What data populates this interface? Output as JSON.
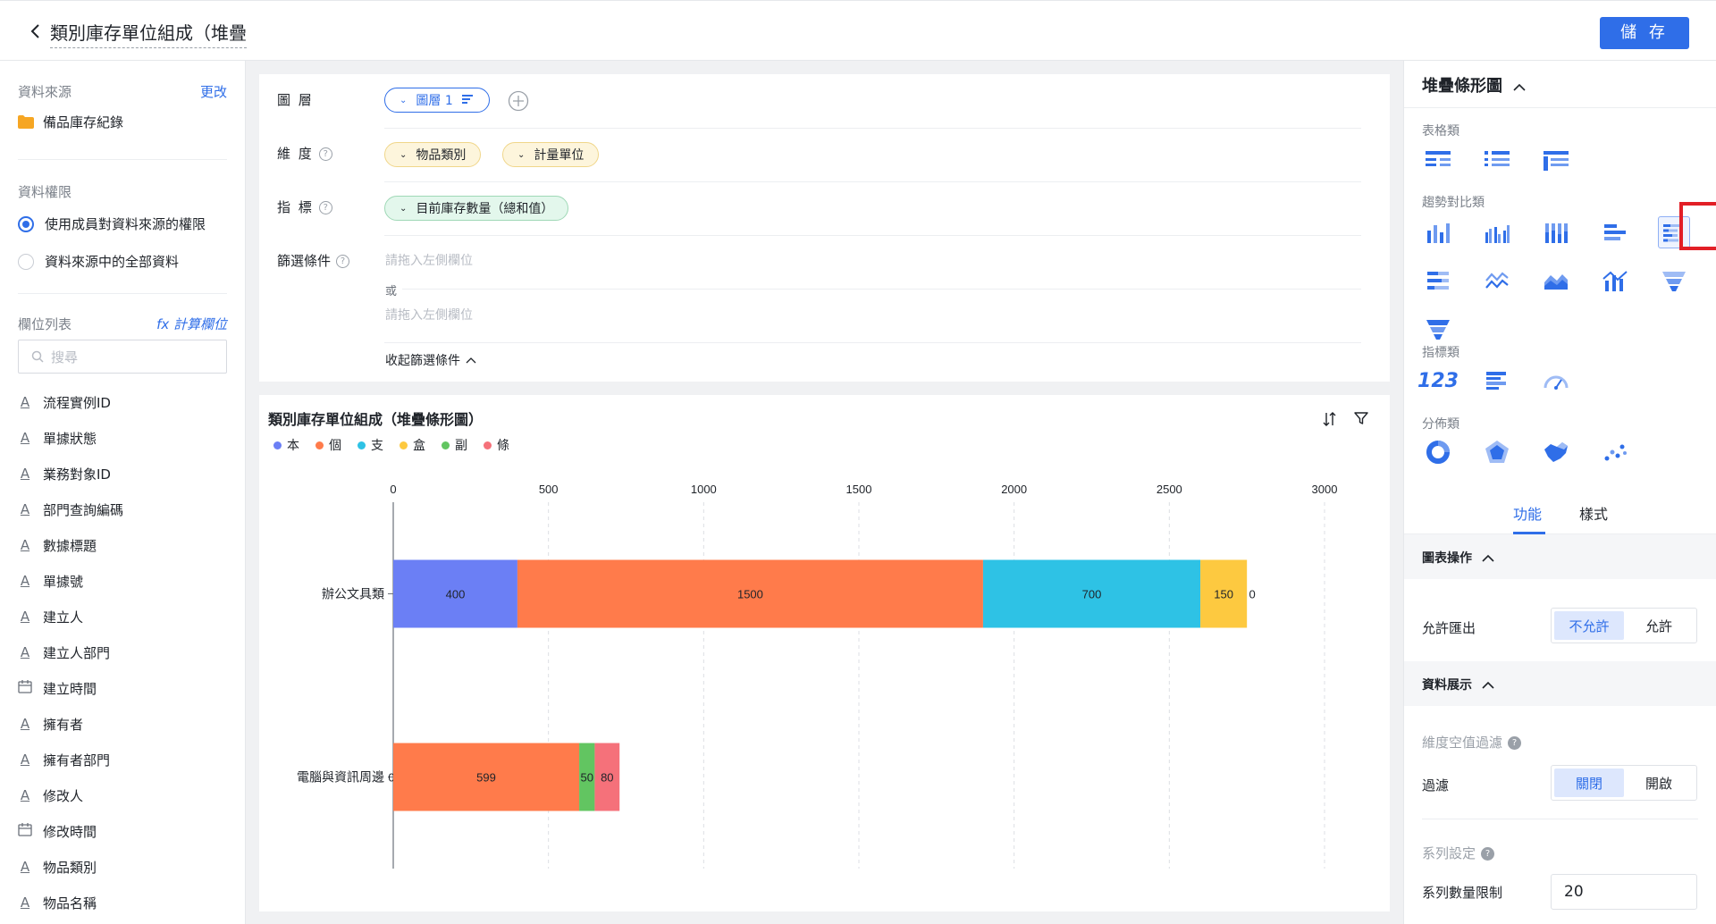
{
  "header": {
    "title": "類別庫存單位組成（堆疊",
    "save_label": "儲 存"
  },
  "left": {
    "source_label": "資料來源",
    "change_link": "更改",
    "source_name": "備品庫存紀錄",
    "perm_label": "資料權限",
    "perm_options": [
      "使用成員對資料來源的權限",
      "資料來源中的全部資料"
    ],
    "fields_label": "欄位列表",
    "calc_link": "fx 計算欄位",
    "search_placeholder": "搜尋",
    "fields": [
      {
        "name": "流程實例ID",
        "type": "A"
      },
      {
        "name": "單據狀態",
        "type": "A"
      },
      {
        "name": "業務對象ID",
        "type": "A"
      },
      {
        "name": "部門查詢編碼",
        "type": "A"
      },
      {
        "name": "數據標題",
        "type": "A"
      },
      {
        "name": "單據號",
        "type": "A"
      },
      {
        "name": "建立人",
        "type": "A"
      },
      {
        "name": "建立人部門",
        "type": "A"
      },
      {
        "name": "建立時間",
        "type": "date"
      },
      {
        "name": "擁有者",
        "type": "A"
      },
      {
        "name": "擁有者部門",
        "type": "A"
      },
      {
        "name": "修改人",
        "type": "A"
      },
      {
        "name": "修改時間",
        "type": "date"
      },
      {
        "name": "物品類別",
        "type": "A"
      },
      {
        "name": "物品名稱",
        "type": "A"
      }
    ]
  },
  "config": {
    "layer_label": "圖 層",
    "layer_pill": "圖層 1",
    "dim_label": "維 度",
    "dim_pills": [
      "物品類別",
      "計量單位"
    ],
    "metric_label": "指 標",
    "metric_pill": "目前庫存數量（總和值）",
    "filter_label": "篩選條件",
    "filter_placeholder": "請拖入左側欄位",
    "or_label": "或",
    "collapse_label": "收起篩選條件"
  },
  "chart_data": {
    "type": "bar",
    "orientation": "horizontal",
    "stacked": true,
    "title": "類別庫存單位組成（堆疊條形圖）",
    "categories": [
      "辦公文具類",
      "電腦與資訊周邊"
    ],
    "xlim": [
      0,
      3000
    ],
    "x_ticks": [
      0,
      500,
      1000,
      1500,
      2000,
      2500,
      3000
    ],
    "legend_position": "top-left",
    "grid": true,
    "series": [
      {
        "name": "本",
        "color": "#6b7ff5",
        "values": [
          400,
          0
        ]
      },
      {
        "name": "個",
        "color": "#ff7b4b",
        "values": [
          1500,
          599
        ]
      },
      {
        "name": "支",
        "color": "#2ec2e5",
        "values": [
          700,
          0
        ]
      },
      {
        "name": "盒",
        "color": "#fdc940",
        "values": [
          150,
          0
        ]
      },
      {
        "name": "副",
        "color": "#62c561",
        "values": [
          0,
          50
        ]
      },
      {
        "name": "條",
        "color": "#f5717a",
        "values": [
          0,
          80
        ]
      }
    ]
  },
  "right": {
    "chart_type_title": "堆疊條形圖",
    "cat_table": "表格類",
    "cat_trend": "趨勢對比類",
    "cat_metric": "指標類",
    "cat_dist": "分佈類",
    "metric_123": "123",
    "tabs": [
      "功能",
      "樣式"
    ],
    "grp_ops": "圖表操作",
    "allow_export_label": "允許匯出",
    "export_options": [
      "不允許",
      "允許"
    ],
    "grp_data": "資料展示",
    "dim_null_label": "維度空值過濾",
    "filter_label": "過濾",
    "filter_options": [
      "關閉",
      "開啟"
    ],
    "series_settings_label": "系列設定",
    "series_limit_label": "系列數量限制",
    "series_limit_value": "20"
  },
  "colors": {
    "accent": "#2f6ee8",
    "highlight": "#e21f26"
  }
}
